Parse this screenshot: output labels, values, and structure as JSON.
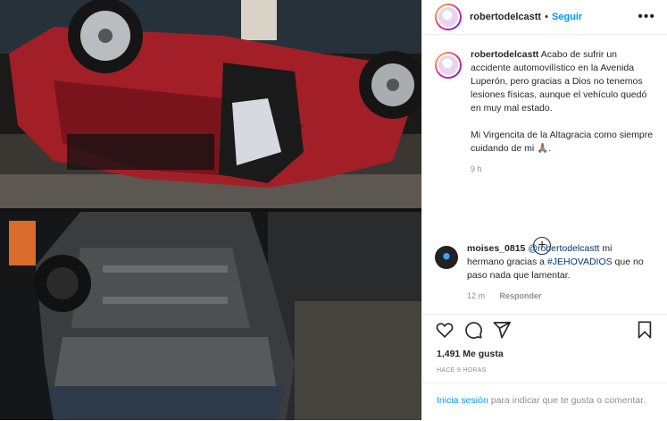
{
  "post": {
    "username": "robertodelcastt",
    "follow_label": "Seguir",
    "separator": "•",
    "more_label": "•••",
    "caption_user": "robertodelcastt",
    "caption_text": "Acabo de sufrir un accidente automovilístico en la Avenida Luperón, pero gracias a Dios no tenemos lesiones físicas, aunque el vehículo quedó en muy mal estado.",
    "caption_text_2": "Mi Virgencita de la Altagracia como siempre cuidando de mi 🙏🏽.",
    "caption_time": "9 h",
    "load_more_label": "+"
  },
  "comment": {
    "username": "moises_0815",
    "mention": "@robertodelcastt",
    "text_1": " mi hermano gracias a ",
    "hashtag": "#JEHOVADIOS",
    "text_2": " que no paso nada que lamentar.",
    "time": "12 m",
    "reply_label": "Responder"
  },
  "engagement": {
    "likes": "1,491 Me gusta",
    "posted": "HACE 9 HORAS",
    "login_link": "Inicia sesión",
    "login_text": " para indicar que te gusta o comentar."
  },
  "icons": {
    "like": "heart-icon",
    "comment": "comment-icon",
    "share": "share-icon",
    "save": "bookmark-icon"
  },
  "colors": {
    "accent": "#0095f6",
    "text": "#262626",
    "muted": "#8e8e8e"
  }
}
